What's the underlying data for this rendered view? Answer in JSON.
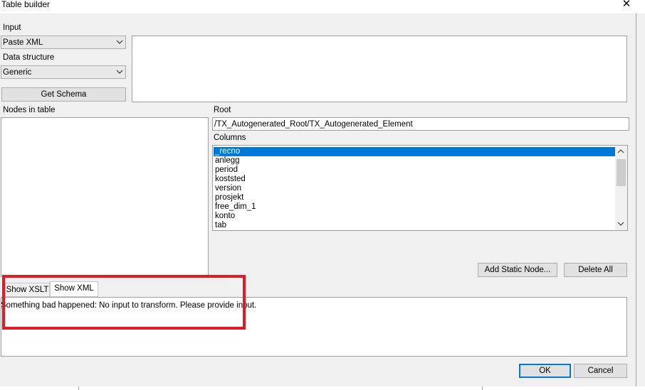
{
  "window": {
    "title": "Table builder"
  },
  "input": {
    "label": "Input",
    "source_value": "Paste XML",
    "structure_label": "Data structure",
    "structure_value": "Generic",
    "get_schema_label": "Get Schema"
  },
  "nodes": {
    "label": "Nodes in table"
  },
  "root": {
    "label": "Root",
    "value": "/TX_Autogenerated_Root/TX_Autogenerated_Element"
  },
  "columns": {
    "label": "Columns",
    "items": [
      "_recno",
      "anlegg",
      "period",
      "koststed",
      "version",
      "prosjekt",
      "free_dim_1",
      "konto",
      "tab"
    ],
    "selected": "_recno"
  },
  "actions": {
    "add_static_node": "Add Static Node...",
    "delete_all": "Delete All"
  },
  "tabs": {
    "xslt": "Show XSLT",
    "xml": "Show XML"
  },
  "output": {
    "message": "Something bad happened: No input to transform. Please provide input."
  },
  "footer": {
    "ok": "OK",
    "cancel": "Cancel"
  },
  "colors": {
    "selection": "#0078d7",
    "highlight": "#e01b24",
    "ok_border": "#0078d7"
  }
}
